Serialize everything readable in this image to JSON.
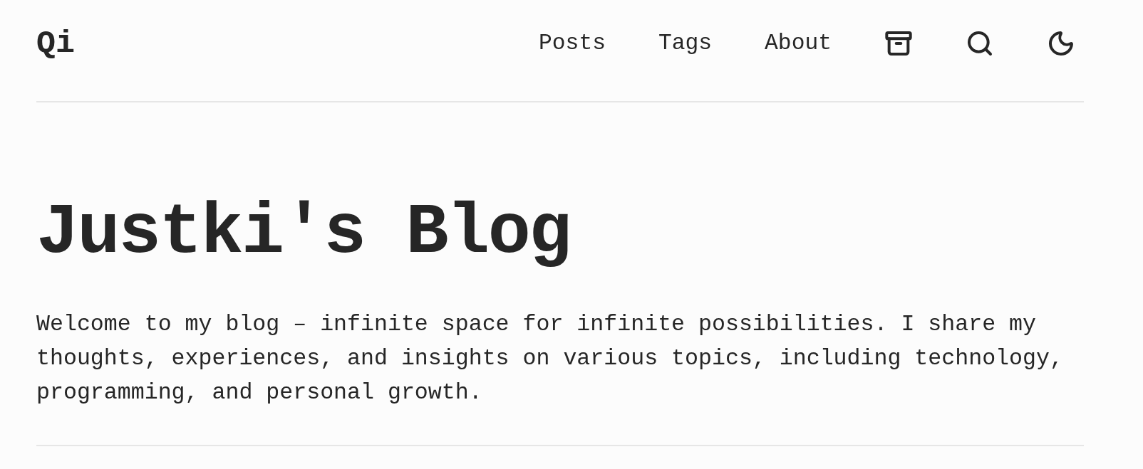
{
  "header": {
    "logo": "Qi",
    "nav": [
      "Posts",
      "Tags",
      "About"
    ]
  },
  "hero": {
    "title": "Justki's Blog",
    "description": "Welcome to my blog – infinite space for infinite possibilities. I share my thoughts, experiences, and insights on various topics, including technology, programming, and personal growth."
  }
}
